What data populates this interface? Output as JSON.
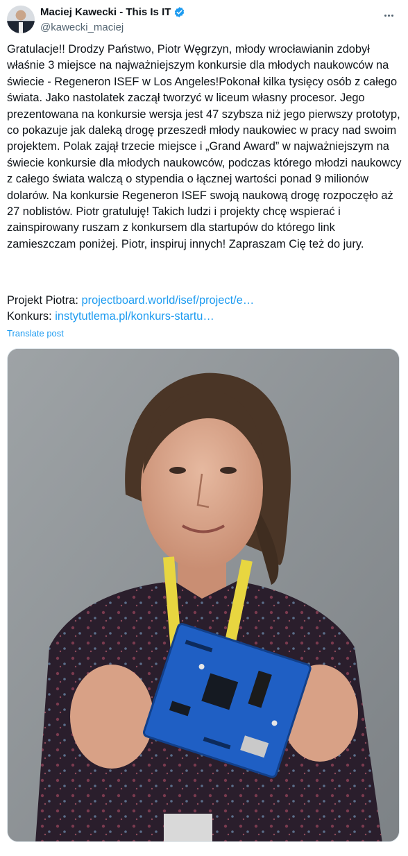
{
  "author": {
    "display_name": "Maciej Kawecki - This Is IT",
    "handle": "@kawecki_maciej",
    "verified_color": "#1d9bf0"
  },
  "tweet": {
    "paragraph": "Gratulacje!! Drodzy Państwo, Piotr Węgrzyn, młody wrocławianin zdobył właśnie 3 miejsce na najważniejszym konkursie dla młodych naukowców na świecie - Regeneron ISEF w Los Angeles!Pokonał kilka tysięcy osób z całego świata. Jako nastolatek zaczął tworzyć w liceum własny procesor. Jego prezentowana na konkursie wersja jest 47 szybsza niż jego pierwszy prototyp, co pokazuje jak daleką drogę przeszedł młody naukowiec w pracy nad swoim projektem. Polak zajął trzecie miejsce i „Grand Award” w najważniejszym na świecie konkursie dla młodych naukowców, podczas którego młodzi naukowcy z całego świata walczą o stypendia o łącznej wartości ponad 9 milionów dolarów. Na konkursie Regeneron ISEF swoją naukową drogę rozpoczęło aż 27 noblistów. Piotr gratuluję! Takich ludzi i projekty chcę wspierać i zainspirowany ruszam z konkursem dla startupów do którego link zamieszczam poniżej. Piotr, inspiruj innych! Zapraszam Cię też do jury.",
    "project_label": "Projekt Piotra:",
    "project_link": "projectboard.world/isef/project/e…",
    "contest_label": "Konkurs:",
    "contest_link": "instytutlema.pl/konkurs-startu…",
    "translate": "Translate post"
  },
  "colors": {
    "link": "#1d9bf0",
    "secondary_text": "#536471"
  },
  "icons": [
    "verified-badge-icon",
    "more-options-icon"
  ]
}
